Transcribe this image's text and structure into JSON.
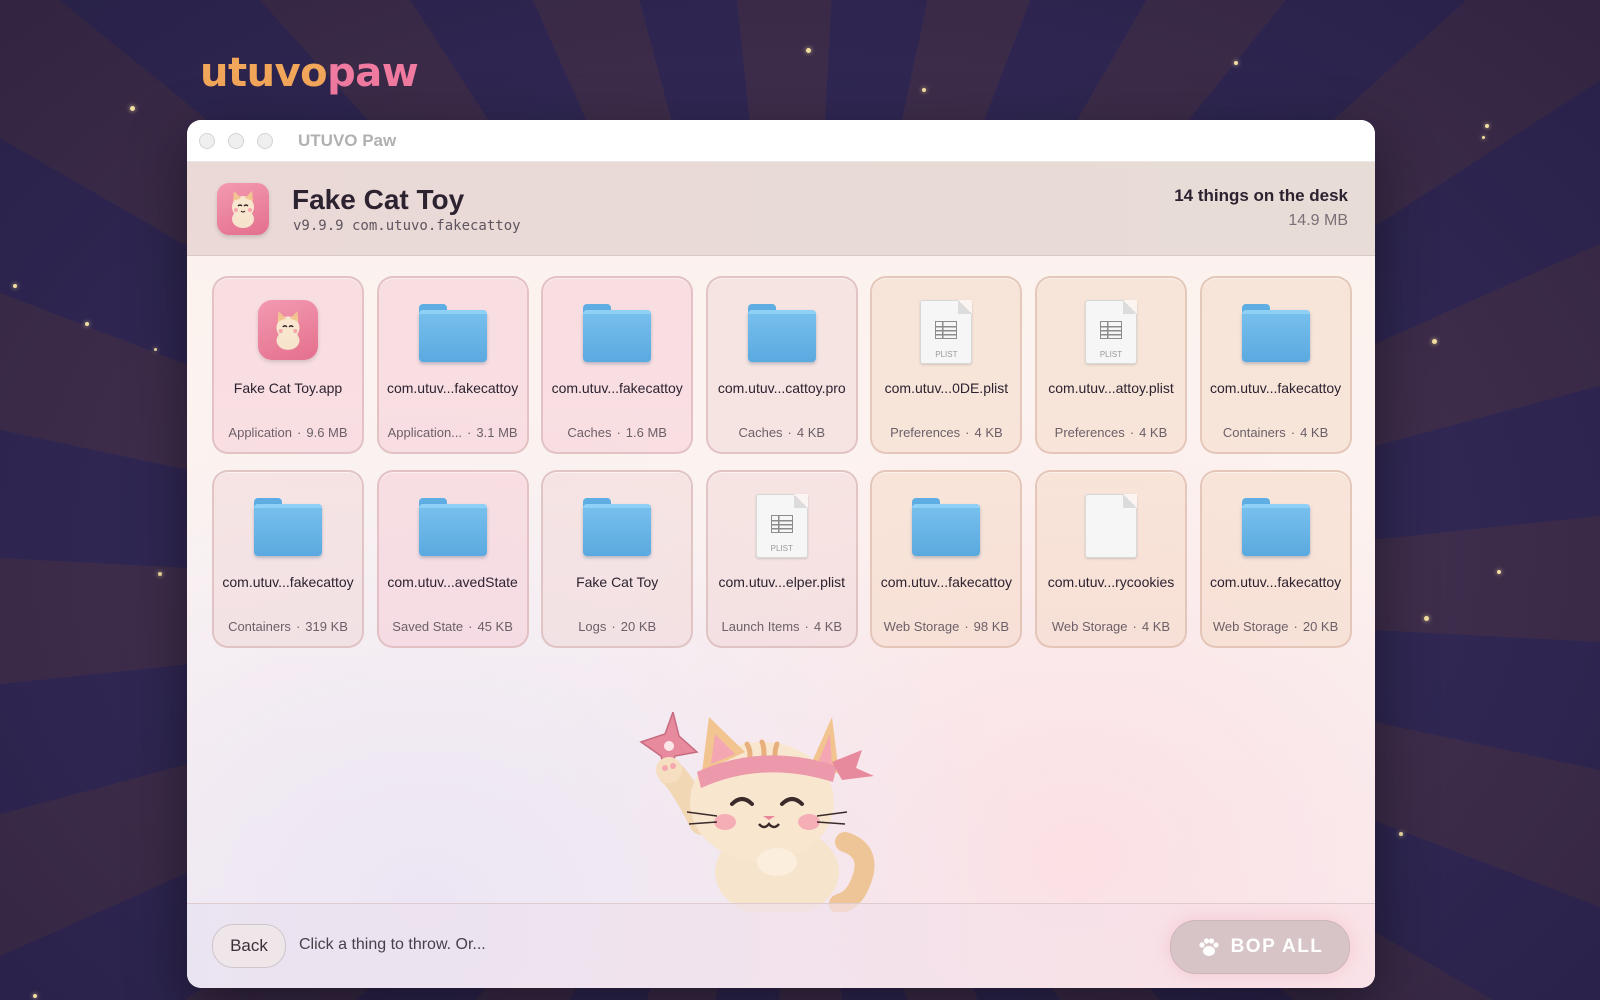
{
  "brand": {
    "logo_part1": "utuvo",
    "logo_part2": "paw"
  },
  "window": {
    "title": "UTUVO Paw"
  },
  "header": {
    "app_name": "Fake Cat Toy",
    "version_line": "v9.9.9 com.utuvo.fakecattoy",
    "count_text": "14 things on the desk",
    "total_size": "14.9 MB"
  },
  "items": [
    {
      "name": "Fake Cat Toy.app",
      "category": "Application",
      "size": "9.6 MB",
      "icon": "app-icon"
    },
    {
      "name": "com.utuv...fakecattoy",
      "category": "Application...",
      "size": "3.1 MB",
      "icon": "folder-icon"
    },
    {
      "name": "com.utuv...fakecattoy",
      "category": "Caches",
      "size": "1.6 MB",
      "icon": "folder-icon"
    },
    {
      "name": "com.utuv...cattoy.pro",
      "category": "Caches",
      "size": "4 KB",
      "icon": "folder-icon"
    },
    {
      "name": "com.utuv...0DE.plist",
      "category": "Preferences",
      "size": "4 KB",
      "icon": "plist-file-icon"
    },
    {
      "name": "com.utuv...attoy.plist",
      "category": "Preferences",
      "size": "4 KB",
      "icon": "plist-file-icon"
    },
    {
      "name": "com.utuv...fakecattoy",
      "category": "Containers",
      "size": "4 KB",
      "icon": "folder-icon"
    },
    {
      "name": "com.utuv...fakecattoy",
      "category": "Containers",
      "size": "319 KB",
      "icon": "folder-icon"
    },
    {
      "name": "com.utuv...avedState",
      "category": "Saved State",
      "size": "45 KB",
      "icon": "folder-icon"
    },
    {
      "name": "Fake Cat Toy",
      "category": "Logs",
      "size": "20 KB",
      "icon": "folder-icon"
    },
    {
      "name": "com.utuv...elper.plist",
      "category": "Launch Items",
      "size": "4 KB",
      "icon": "plist-file-icon"
    },
    {
      "name": "com.utuv...fakecattoy",
      "category": "Web Storage",
      "size": "98 KB",
      "icon": "folder-icon"
    },
    {
      "name": "com.utuv...rycookies",
      "category": "Web Storage",
      "size": "4 KB",
      "icon": "blank-file-icon"
    },
    {
      "name": "com.utuv...fakecattoy",
      "category": "Web Storage",
      "size": "20 KB",
      "icon": "folder-icon"
    }
  ],
  "plist_label": "PLIST",
  "footer": {
    "back_label": "Back",
    "hint": "Click a thing to throw. Or...",
    "bop_label": "BOP ALL"
  },
  "colors": {
    "accent_pink": "#f07aa0",
    "accent_orange": "#f2a65a",
    "folder_blue": "#5aa9e0"
  }
}
